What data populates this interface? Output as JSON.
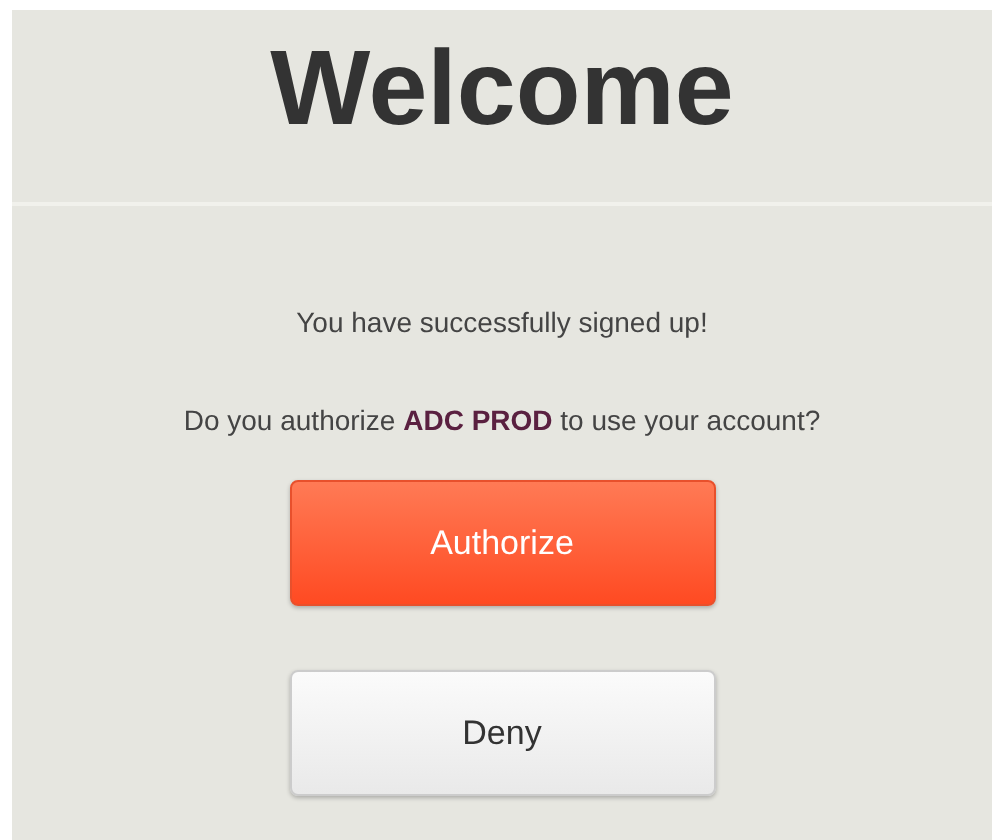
{
  "title": "Welcome",
  "message": "You have successfully signed up!",
  "question": "Do you authorize **ADC PROD** to use your account?",
  "buttons": [
    {
      "label": "Authorize",
      "kind": "primary"
    },
    {
      "label": "Deny",
      "kind": "secondary"
    }
  ]
}
